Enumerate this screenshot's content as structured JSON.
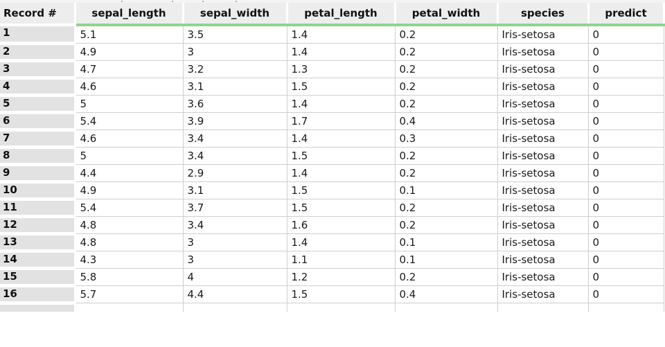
{
  "table": {
    "columns": [
      "Record #",
      "sepal_length",
      "sepal_width",
      "petal_length",
      "petal_width",
      "species",
      "predict"
    ],
    "rows": [
      [
        "1",
        "5.1",
        "3.5",
        "1.4",
        "0.2",
        "Iris-setosa",
        "0"
      ],
      [
        "2",
        "4.9",
        "3",
        "1.4",
        "0.2",
        "Iris-setosa",
        "0"
      ],
      [
        "3",
        "4.7",
        "3.2",
        "1.3",
        "0.2",
        "Iris-setosa",
        "0"
      ],
      [
        "4",
        "4.6",
        "3.1",
        "1.5",
        "0.2",
        "Iris-setosa",
        "0"
      ],
      [
        "5",
        "5",
        "3.6",
        "1.4",
        "0.2",
        "Iris-setosa",
        "0"
      ],
      [
        "6",
        "5.4",
        "3.9",
        "1.7",
        "0.4",
        "Iris-setosa",
        "0"
      ],
      [
        "7",
        "4.6",
        "3.4",
        "1.4",
        "0.3",
        "Iris-setosa",
        "0"
      ],
      [
        "8",
        "5",
        "3.4",
        "1.5",
        "0.2",
        "Iris-setosa",
        "0"
      ],
      [
        "9",
        "4.4",
        "2.9",
        "1.4",
        "0.2",
        "Iris-setosa",
        "0"
      ],
      [
        "10",
        "4.9",
        "3.1",
        "1.5",
        "0.1",
        "Iris-setosa",
        "0"
      ],
      [
        "11",
        "5.4",
        "3.7",
        "1.5",
        "0.2",
        "Iris-setosa",
        "0"
      ],
      [
        "12",
        "4.8",
        "3.4",
        "1.6",
        "0.2",
        "Iris-setosa",
        "0"
      ],
      [
        "13",
        "4.8",
        "3",
        "1.4",
        "0.1",
        "Iris-setosa",
        "0"
      ],
      [
        "14",
        "4.3",
        "3",
        "1.1",
        "0.1",
        "Iris-setosa",
        "0"
      ],
      [
        "15",
        "5.8",
        "4",
        "1.2",
        "0.2",
        "Iris-setosa",
        "0"
      ],
      [
        "16",
        "5.7",
        "4.4",
        "1.5",
        "0.4",
        "Iris-setosa",
        "0"
      ]
    ]
  },
  "colors": {
    "header_underline": "#8ed48b",
    "header_bg": "#ededed",
    "record_col_bg": "#e2e2e2",
    "grid_line": "#cfcfcf"
  }
}
